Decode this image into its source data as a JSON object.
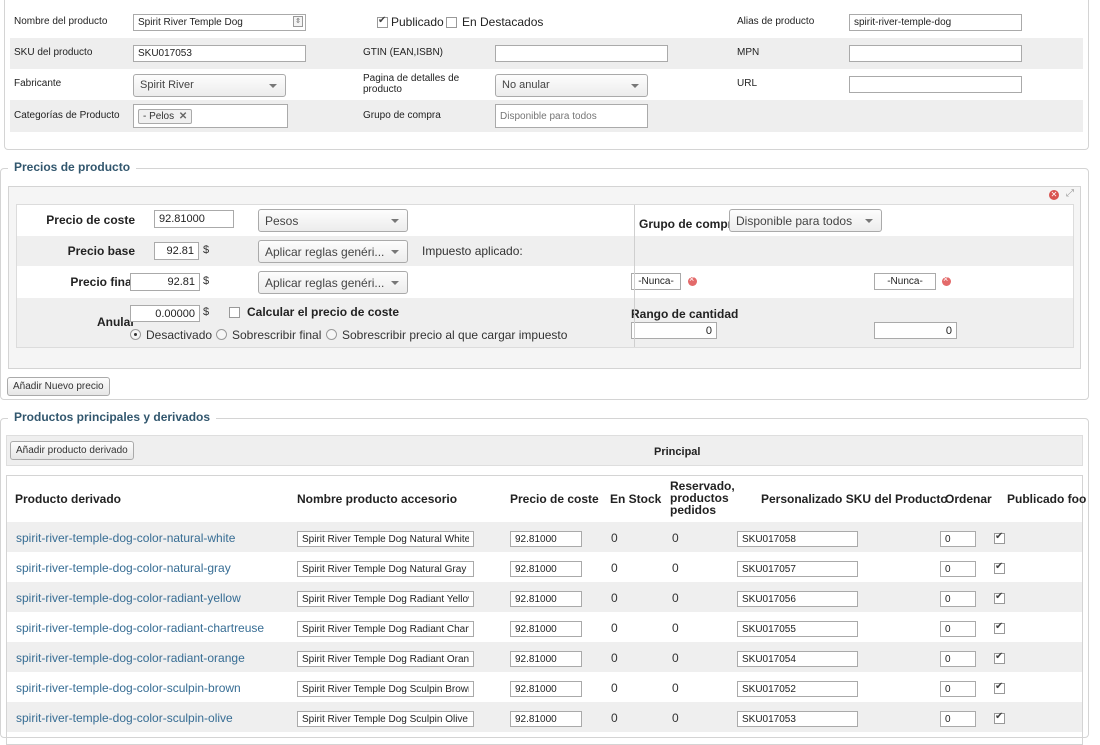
{
  "product": {
    "name_label": "Nombre del producto",
    "name_value": "Spirit River Temple Dog",
    "published_label": "Publicado",
    "featured_label": "En Destacados",
    "alias_label": "Alias de producto",
    "alias_value": "spirit-river-temple-dog",
    "sku_label": "SKU del producto",
    "sku_value": "SKU017053",
    "gtin_label": "GTIN (EAN,ISBN)",
    "gtin_value": "",
    "mpn_label": "MPN",
    "mpn_value": "",
    "manufacturer_label": "Fabricante",
    "manufacturer_value": "Spirit River",
    "details_page_label": "Pagina de detalles de producto",
    "details_page_value": "No anular",
    "url_label": "URL",
    "url_value": "",
    "categories_label": "Categorías de Producto",
    "category_tag": "- Pelos",
    "shopper_group_label": "Grupo de compra",
    "shopper_group_placeholder": "Disponible para todos"
  },
  "prices": {
    "legend": "Precios de producto",
    "cost_label": "Precio de coste",
    "cost_value": "92.81000",
    "currency": "Pesos",
    "base_label": "Precio base",
    "base_value": "92.81",
    "base_currency_symbol": "$",
    "rules_select": "Aplicar reglas genéri...",
    "tax_applied_label": "Impuesto aplicado:",
    "final_label": "Precio final",
    "final_value": "92.81",
    "final_currency_symbol": "$",
    "final_rules_select": "Aplicar reglas genéri...",
    "override_label": "Anular",
    "override_value": "0.00000",
    "override_currency_symbol": "$",
    "calc_cost_label": "Calcular el precio de coste",
    "radio_disabled": "Desactivado",
    "radio_overwrite_final": "Sobrescribir final",
    "radio_overwrite_tax": "Sobrescribir precio al que cargar impuesto",
    "group_label": "Grupo de compra",
    "group_value": "Disponible para todos",
    "never_from": "-Nunca-",
    "never_to": "-Nunca-",
    "quantity_range_label": "Rango de cantidad",
    "qty_from": "0",
    "qty_to": "0",
    "add_price_button": "Añadir Nuevo precio"
  },
  "children": {
    "legend": "Productos principales y derivados",
    "add_child_button": "Añadir producto derivado",
    "principal_label": "Principal",
    "columns": [
      "Producto derivado",
      "Nombre producto accesorio",
      "Precio de coste",
      "En Stock",
      "Reservado, productos pedidos",
      "Personalizado SKU del Producto",
      "Ordenar",
      "Publicado foo"
    ],
    "rows": [
      {
        "slug": "spirit-river-temple-dog-color-natural-white",
        "name": "Spirit River Temple Dog Natural White",
        "cost": "92.81000",
        "stock": "0",
        "reserved": "0",
        "sku": "SKU017058",
        "order": "0"
      },
      {
        "slug": "spirit-river-temple-dog-color-natural-gray",
        "name": "Spirit River Temple Dog Natural Gray",
        "cost": "92.81000",
        "stock": "0",
        "reserved": "0",
        "sku": "SKU017057",
        "order": "0"
      },
      {
        "slug": "spirit-river-temple-dog-color-radiant-yellow",
        "name": "Spirit River Temple Dog Radiant Yellov",
        "cost": "92.81000",
        "stock": "0",
        "reserved": "0",
        "sku": "SKU017056",
        "order": "0"
      },
      {
        "slug": "spirit-river-temple-dog-color-radiant-chartreuse",
        "name": "Spirit River Temple Dog Radiant Chart",
        "cost": "92.81000",
        "stock": "0",
        "reserved": "0",
        "sku": "SKU017055",
        "order": "0"
      },
      {
        "slug": "spirit-river-temple-dog-color-radiant-orange",
        "name": "Spirit River Temple Dog Radiant Orang",
        "cost": "92.81000",
        "stock": "0",
        "reserved": "0",
        "sku": "SKU017054",
        "order": "0"
      },
      {
        "slug": "spirit-river-temple-dog-color-sculpin-brown",
        "name": "Spirit River Temple Dog Sculpin Brown",
        "cost": "92.81000",
        "stock": "0",
        "reserved": "0",
        "sku": "SKU017052",
        "order": "0"
      },
      {
        "slug": "spirit-river-temple-dog-color-sculpin-olive",
        "name": "Spirit River Temple Dog Sculpin Olive",
        "cost": "92.81000",
        "stock": "0",
        "reserved": "0",
        "sku": "SKU017053",
        "order": "0"
      }
    ]
  },
  "colors": {
    "link": "#376d94",
    "legend": "#32576e",
    "row_alt": "#efefef"
  }
}
